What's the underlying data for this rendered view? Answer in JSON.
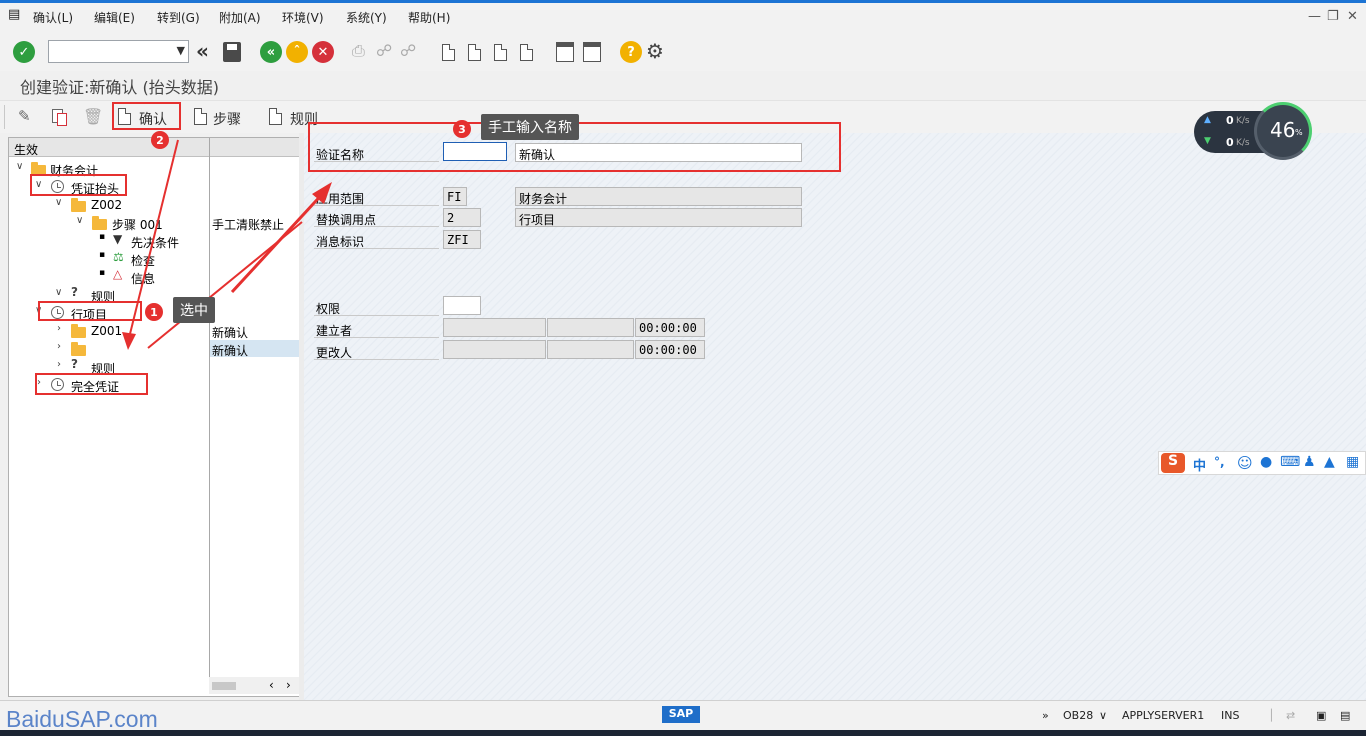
{
  "menu": {
    "items": [
      "确认(L)",
      "编辑(E)",
      "转到(G)",
      "附加(A)",
      "环境(V)",
      "系统(Y)",
      "帮助(H)"
    ]
  },
  "window": {
    "title": "创建验证:新确认 (抬头数据)"
  },
  "app_toolbar": {
    "confirm": "确认",
    "steps": "步骤",
    "rules": "规则"
  },
  "tree": {
    "header": "生效",
    "nodes": [
      {
        "label": "财务会计",
        "col2": ""
      },
      {
        "label": "凭证抬头",
        "col2": ""
      },
      {
        "label": "Z002",
        "col2": ""
      },
      {
        "label": "步骤 001",
        "col2": "手工清账禁止"
      },
      {
        "label": "先决条件",
        "col2": ""
      },
      {
        "label": "检查",
        "col2": ""
      },
      {
        "label": "信息",
        "col2": ""
      },
      {
        "label": "规则",
        "col2": ""
      },
      {
        "label": "行项目",
        "col2": ""
      },
      {
        "label": "Z001",
        "col2": "新确认"
      },
      {
        "label": "",
        "col2": "新确认"
      },
      {
        "label": "规则",
        "col2": ""
      },
      {
        "label": "完全凭证",
        "col2": ""
      }
    ]
  },
  "form": {
    "validation_name_label": "验证名称",
    "validation_name_value": "",
    "validation_desc": "新确认",
    "app_area_label": "应用范围",
    "app_area_code": "FI",
    "app_area_text": "财务会计",
    "callup_label": "替换调用点",
    "callup_code": "2",
    "callup_text": "行项目",
    "msg_id_label": "消息标识",
    "msg_id_value": "ZFI",
    "auth_label": "权限",
    "auth_value": "",
    "created_by_label": "建立者",
    "created_time": "00:00:00",
    "changed_by_label": "更改人",
    "changed_time": "00:00:00"
  },
  "annotations": {
    "badge1": "1",
    "tip1": "选中",
    "badge2": "2",
    "badge3": "3",
    "tip3": "手工输入名称"
  },
  "net_widget": {
    "up": "0",
    "down": "0",
    "unit": "K/s",
    "percent": "46",
    "percent_sign": "%"
  },
  "ime": {
    "mode": "中",
    "punct": "°,"
  },
  "status_bar": {
    "logo": "SAP",
    "tcode": "OB28",
    "server": "APPLYSERVER1",
    "mode": "INS"
  },
  "watermark": "BaiduSAP.com",
  "colors": {
    "accent": "#1d74d4",
    "annotation_red": "#e5302f",
    "green": "#2e9e3f",
    "amber": "#f2b100",
    "cancel_red": "#d5303a"
  }
}
